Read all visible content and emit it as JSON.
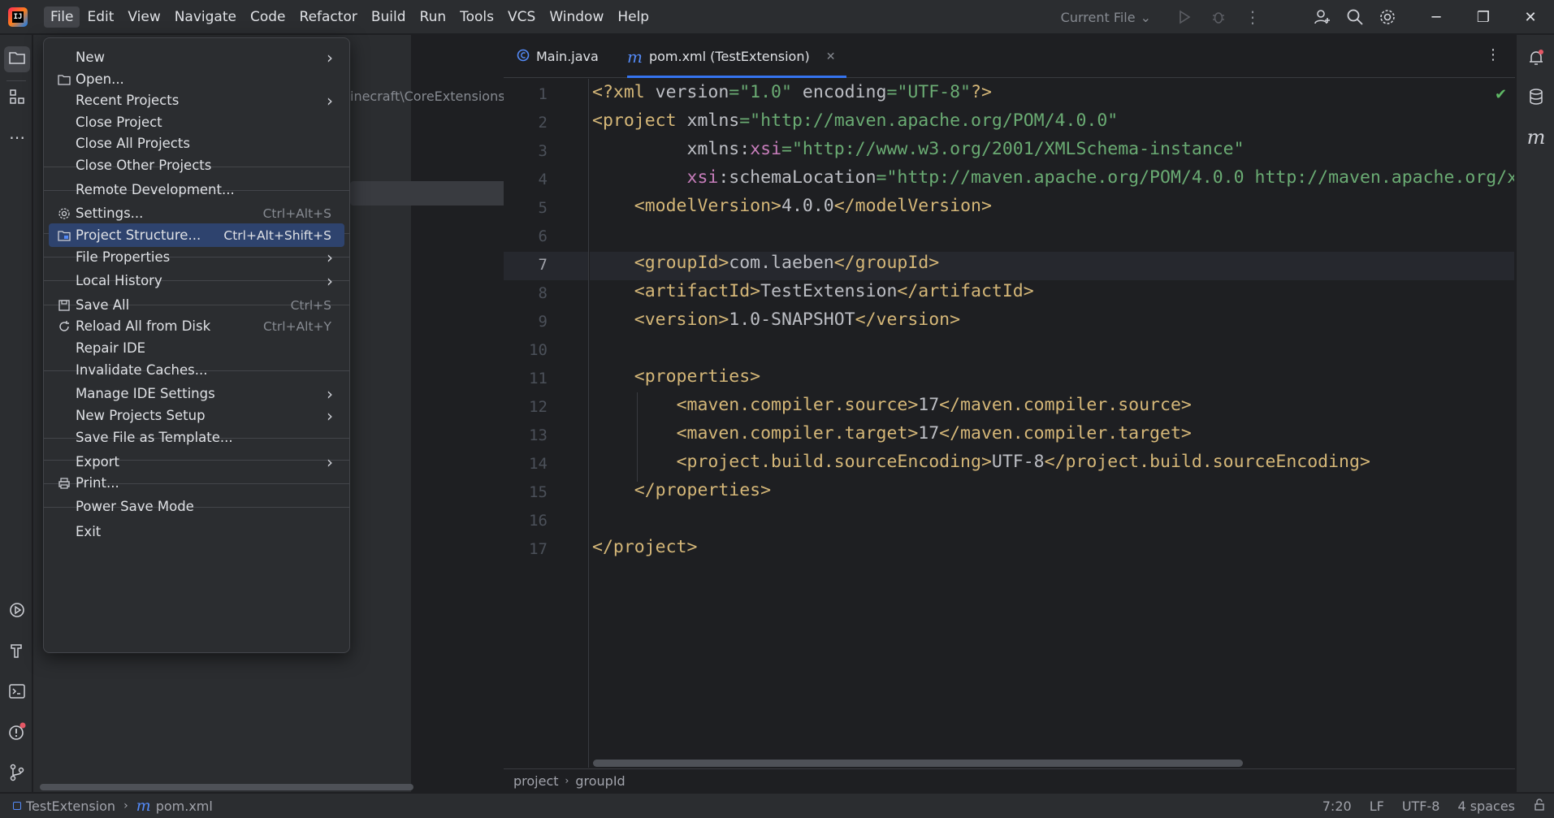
{
  "titlebar": {
    "menus": [
      "File",
      "Edit",
      "View",
      "Navigate",
      "Code",
      "Refactor",
      "Build",
      "Run",
      "Tools",
      "VCS",
      "Window",
      "Help"
    ],
    "run_config": "Current File"
  },
  "project_panel": {
    "path_fragment": "inecraft\\CoreExtensions"
  },
  "tabs": [
    {
      "label": "Main.java",
      "icon": "java-class-icon"
    },
    {
      "label": "pom.xml (TestExtension)",
      "icon": "maven-icon"
    }
  ],
  "editor": {
    "line_numbers": [
      "1",
      "2",
      "3",
      "4",
      "5",
      "6",
      "7",
      "8",
      "9",
      "10",
      "11",
      "12",
      "13",
      "14",
      "15",
      "16",
      "17"
    ],
    "current_line": "7"
  },
  "breadcrumb": [
    "project",
    "groupId"
  ],
  "statusbar": {
    "project": "TestExtension",
    "file": "pom.xml",
    "position": "7:20",
    "line_sep": "LF",
    "encoding": "UTF-8",
    "indent": "4 spaces"
  },
  "file_menu": {
    "items": [
      {
        "label": "New",
        "shortcut": "",
        "submenu": true,
        "icon": ""
      },
      {
        "label": "Open...",
        "shortcut": "",
        "submenu": false,
        "icon": "folder-icon"
      },
      {
        "label": "Recent Projects",
        "shortcut": "",
        "submenu": true,
        "icon": ""
      },
      {
        "label": "Close Project",
        "shortcut": "",
        "submenu": false,
        "icon": ""
      },
      {
        "label": "Close All Projects",
        "shortcut": "",
        "submenu": false,
        "icon": ""
      },
      {
        "label": "Close Other Projects",
        "shortcut": "",
        "submenu": false,
        "icon": ""
      },
      {
        "label": "Remote Development...",
        "shortcut": "",
        "submenu": false,
        "icon": ""
      },
      {
        "label": "Settings...",
        "shortcut": "Ctrl+Alt+S",
        "submenu": false,
        "icon": "gear-icon"
      },
      {
        "label": "Project Structure...",
        "shortcut": "Ctrl+Alt+Shift+S",
        "submenu": false,
        "icon": "project-structure-icon"
      },
      {
        "label": "File Properties",
        "shortcut": "",
        "submenu": true,
        "icon": ""
      },
      {
        "label": "Local History",
        "shortcut": "",
        "submenu": true,
        "icon": ""
      },
      {
        "label": "Save All",
        "shortcut": "Ctrl+S",
        "submenu": false,
        "icon": "save-icon"
      },
      {
        "label": "Reload All from Disk",
        "shortcut": "Ctrl+Alt+Y",
        "submenu": false,
        "icon": "reload-icon"
      },
      {
        "label": "Repair IDE",
        "shortcut": "",
        "submenu": false,
        "icon": ""
      },
      {
        "label": "Invalidate Caches...",
        "shortcut": "",
        "submenu": false,
        "icon": ""
      },
      {
        "label": "Manage IDE Settings",
        "shortcut": "",
        "submenu": true,
        "icon": ""
      },
      {
        "label": "New Projects Setup",
        "shortcut": "",
        "submenu": true,
        "icon": ""
      },
      {
        "label": "Save File as Template...",
        "shortcut": "",
        "submenu": false,
        "icon": ""
      },
      {
        "label": "Export",
        "shortcut": "",
        "submenu": true,
        "icon": ""
      },
      {
        "label": "Print...",
        "shortcut": "",
        "submenu": false,
        "icon": "print-icon"
      },
      {
        "label": "Power Save Mode",
        "shortcut": "",
        "submenu": false,
        "icon": ""
      },
      {
        "label": "Exit",
        "shortcut": "",
        "submenu": false,
        "icon": ""
      }
    ]
  }
}
